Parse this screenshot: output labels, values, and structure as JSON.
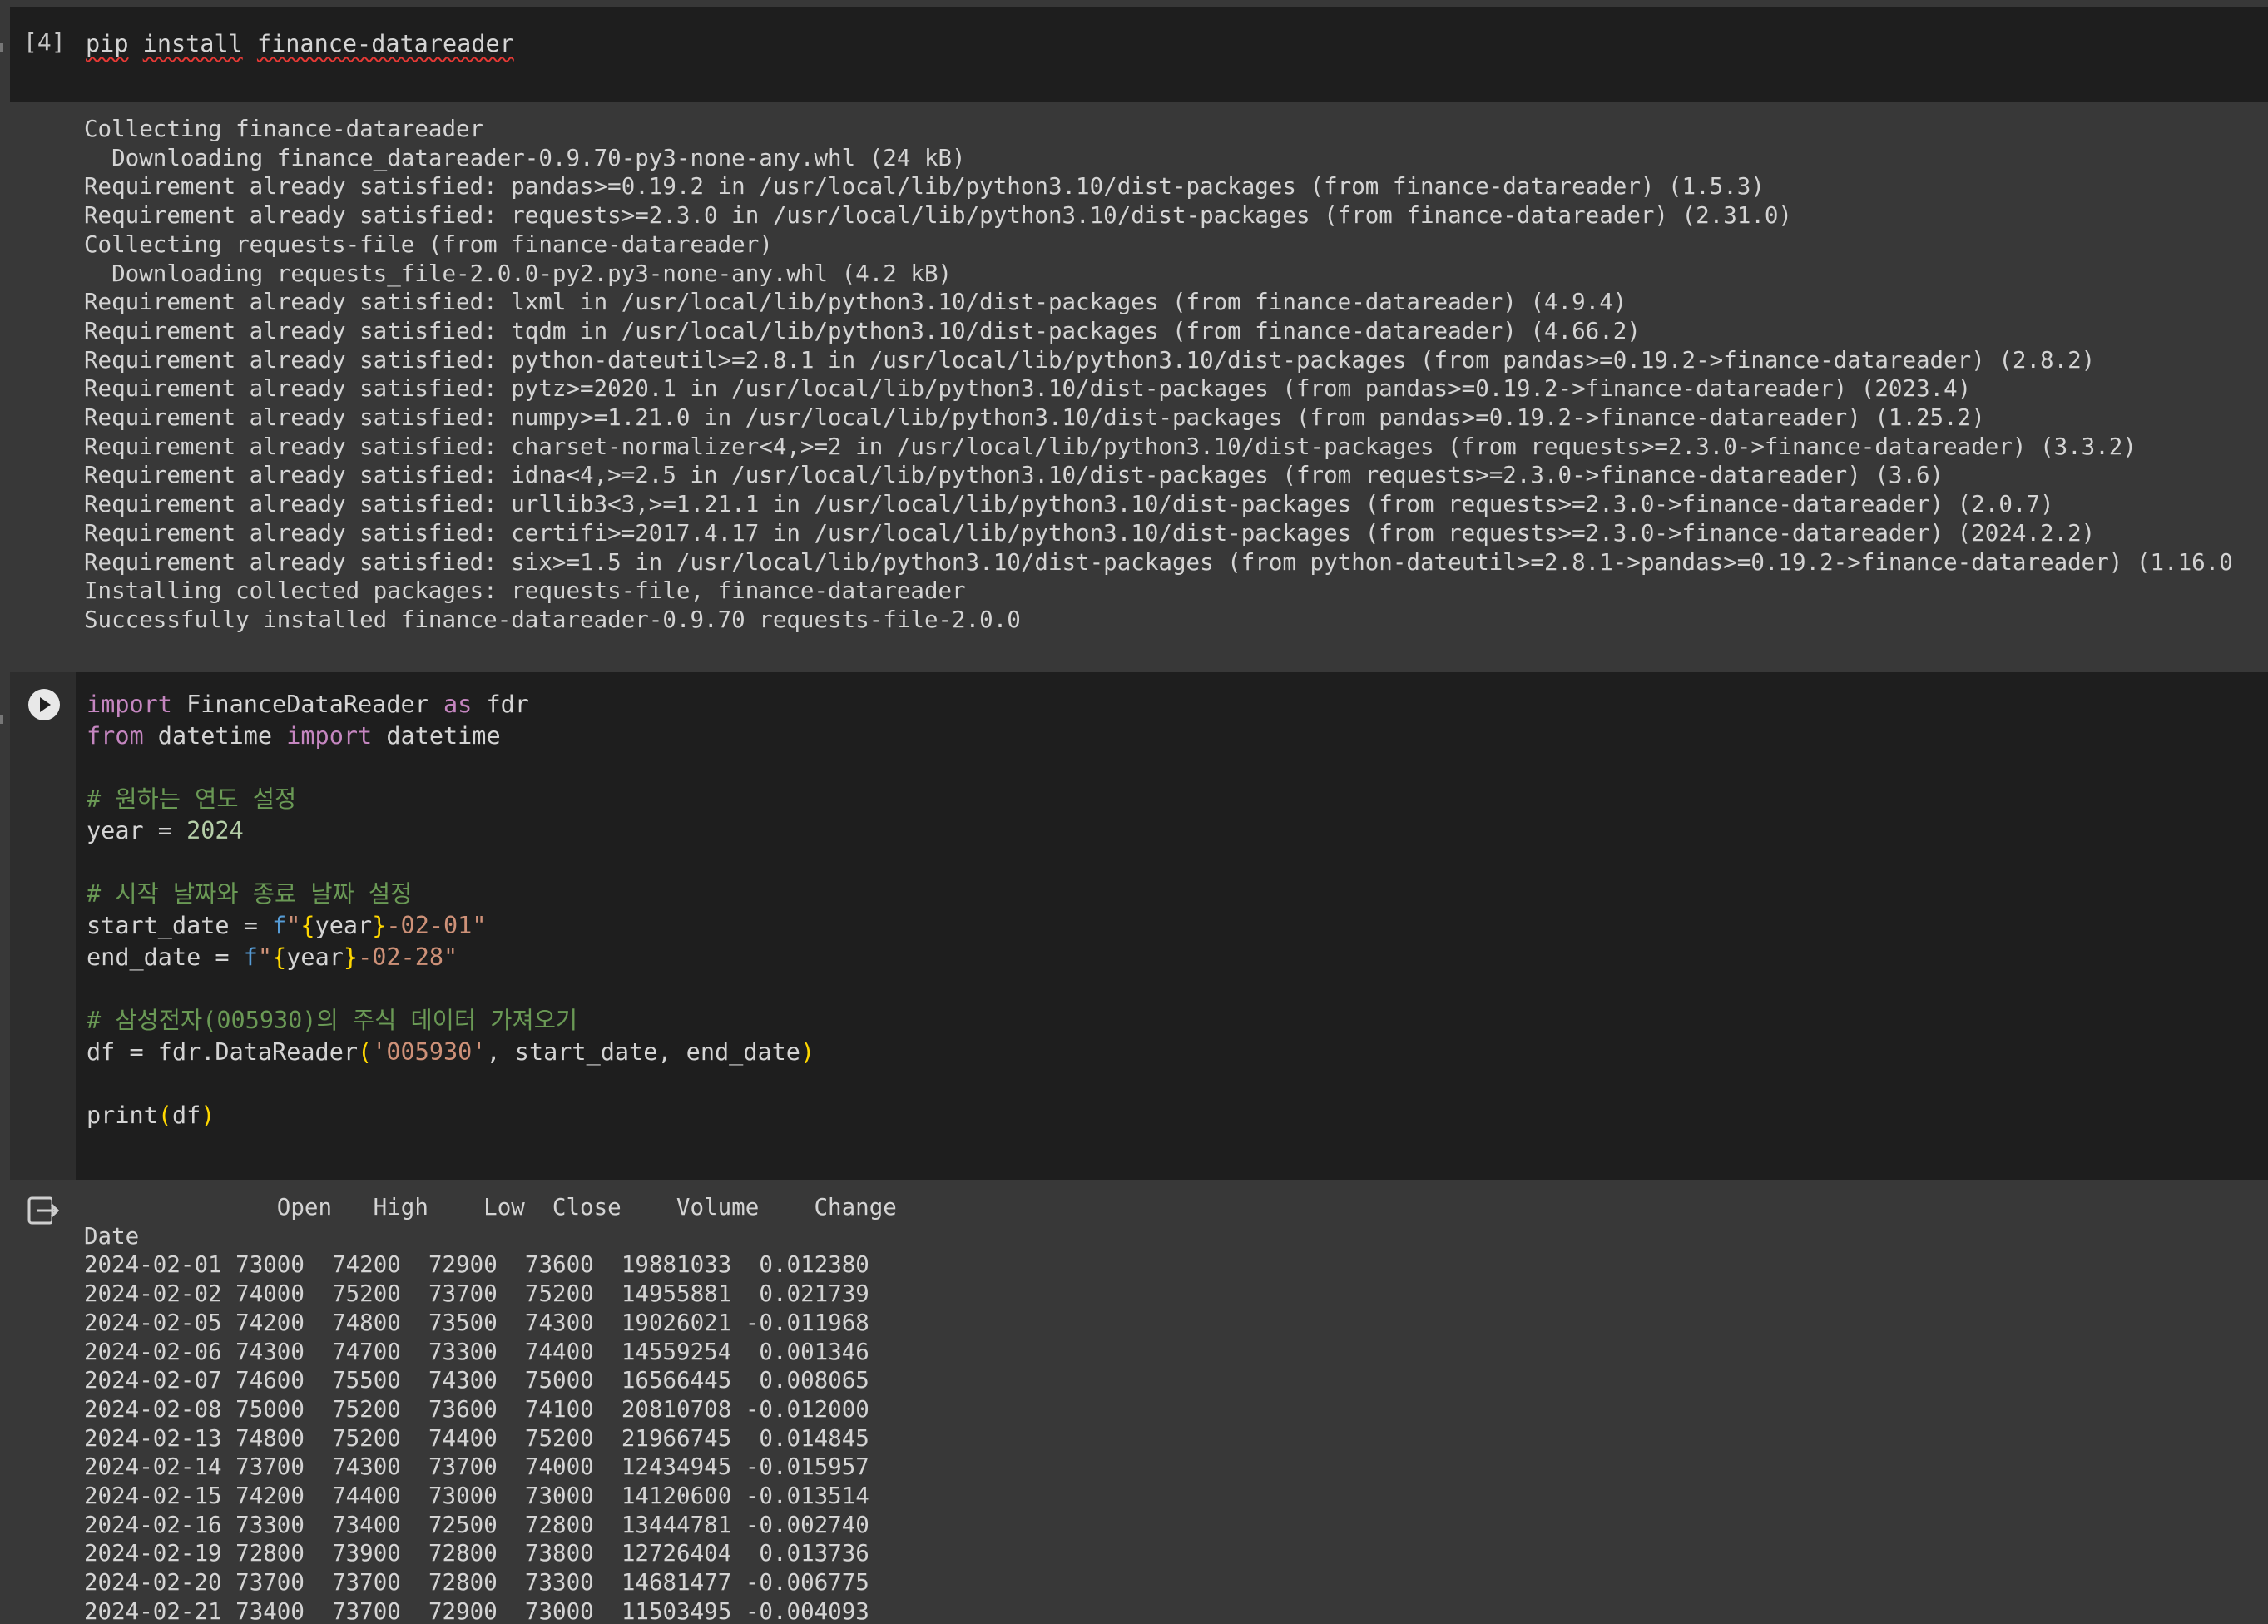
{
  "cell1": {
    "execution_count": "[4]",
    "code_words": [
      "pip",
      "install",
      "finance-datareader"
    ],
    "output_lines": [
      "Collecting finance-datareader",
      "  Downloading finance_datareader-0.9.70-py3-none-any.whl (24 kB)",
      "Requirement already satisfied: pandas>=0.19.2 in /usr/local/lib/python3.10/dist-packages (from finance-datareader) (1.5.3)",
      "Requirement already satisfied: requests>=2.3.0 in /usr/local/lib/python3.10/dist-packages (from finance-datareader) (2.31.0)",
      "Collecting requests-file (from finance-datareader)",
      "  Downloading requests_file-2.0.0-py2.py3-none-any.whl (4.2 kB)",
      "Requirement already satisfied: lxml in /usr/local/lib/python3.10/dist-packages (from finance-datareader) (4.9.4)",
      "Requirement already satisfied: tqdm in /usr/local/lib/python3.10/dist-packages (from finance-datareader) (4.66.2)",
      "Requirement already satisfied: python-dateutil>=2.8.1 in /usr/local/lib/python3.10/dist-packages (from pandas>=0.19.2->finance-datareader) (2.8.2)",
      "Requirement already satisfied: pytz>=2020.1 in /usr/local/lib/python3.10/dist-packages (from pandas>=0.19.2->finance-datareader) (2023.4)",
      "Requirement already satisfied: numpy>=1.21.0 in /usr/local/lib/python3.10/dist-packages (from pandas>=0.19.2->finance-datareader) (1.25.2)",
      "Requirement already satisfied: charset-normalizer<4,>=2 in /usr/local/lib/python3.10/dist-packages (from requests>=2.3.0->finance-datareader) (3.3.2)",
      "Requirement already satisfied: idna<4,>=2.5 in /usr/local/lib/python3.10/dist-packages (from requests>=2.3.0->finance-datareader) (3.6)",
      "Requirement already satisfied: urllib3<3,>=1.21.1 in /usr/local/lib/python3.10/dist-packages (from requests>=2.3.0->finance-datareader) (2.0.7)",
      "Requirement already satisfied: certifi>=2017.4.17 in /usr/local/lib/python3.10/dist-packages (from requests>=2.3.0->finance-datareader) (2024.2.2)",
      "Requirement already satisfied: six>=1.5 in /usr/local/lib/python3.10/dist-packages (from python-dateutil>=2.8.1->pandas>=0.19.2->finance-datareader) (1.16.0",
      "Installing collected packages: requests-file, finance-datareader",
      "Successfully installed finance-datareader-0.9.70 requests-file-2.0.0"
    ]
  },
  "cell2": {
    "code": {
      "l1_import": "import",
      "l1_module": " FinanceDataReader ",
      "l1_as": "as",
      "l1_alias": " fdr",
      "l2_from": "from",
      "l2_module": " datetime ",
      "l2_import": "import",
      "l2_name": " datetime",
      "c1": "# 원하는 연도 설정",
      "l3_var": "year = ",
      "l3_val": "2024",
      "c2": "# 시작 날짜와 종료 날짜 설정",
      "l4_var": "start_date = ",
      "l4_f": "f",
      "l4_q": "\"",
      "l4_lb": "{",
      "l4_name": "year",
      "l4_rb": "}",
      "l4_rest": "-02-01\"",
      "l5_var": "end_date = ",
      "l5_f": "f",
      "l5_q": "\"",
      "l5_lb": "{",
      "l5_name": "year",
      "l5_rb": "}",
      "l5_rest": "-02-28\"",
      "c3": "# 삼성전자(005930)의 주식 데이터 가져오기",
      "l6_pre": "df = fdr.DataReader",
      "l6_lp": "(",
      "l6_str": "'005930'",
      "l6_args": ", start_date, end_date",
      "l6_rp": ")",
      "l7_fn": "print",
      "l7_lp": "(",
      "l7_arg": "df",
      "l7_rp": ")"
    }
  },
  "output2": {
    "header_line": "              Open   High    Low  Close    Volume    Change",
    "index_label": "Date",
    "columns": [
      "Open",
      "High",
      "Low",
      "Close",
      "Volume",
      "Change"
    ],
    "rows": [
      [
        "2024-02-01",
        "73000",
        "74200",
        "72900",
        "73600",
        "19881033",
        "0.012380"
      ],
      [
        "2024-02-02",
        "74000",
        "75200",
        "73700",
        "75200",
        "14955881",
        "0.021739"
      ],
      [
        "2024-02-05",
        "74200",
        "74800",
        "73500",
        "74300",
        "19026021",
        "-0.011968"
      ],
      [
        "2024-02-06",
        "74300",
        "74700",
        "73300",
        "74400",
        "14559254",
        "0.001346"
      ],
      [
        "2024-02-07",
        "74600",
        "75500",
        "74300",
        "75000",
        "16566445",
        "0.008065"
      ],
      [
        "2024-02-08",
        "75000",
        "75200",
        "73600",
        "74100",
        "20810708",
        "-0.012000"
      ],
      [
        "2024-02-13",
        "74800",
        "75200",
        "74400",
        "75200",
        "21966745",
        "0.014845"
      ],
      [
        "2024-02-14",
        "73700",
        "74300",
        "73700",
        "74000",
        "12434945",
        "-0.015957"
      ],
      [
        "2024-02-15",
        "74200",
        "74400",
        "73000",
        "73000",
        "14120600",
        "-0.013514"
      ],
      [
        "2024-02-16",
        "73300",
        "73400",
        "72500",
        "72800",
        "13444781",
        "-0.002740"
      ],
      [
        "2024-02-19",
        "72800",
        "73900",
        "72800",
        "73800",
        "12726404",
        "0.013736"
      ],
      [
        "2024-02-20",
        "73700",
        "73700",
        "72800",
        "73300",
        "14681477",
        "-0.006775"
      ],
      [
        "2024-02-21",
        "73400",
        "73700",
        "72900",
        "73000",
        "11503495",
        "-0.004093"
      ]
    ]
  }
}
